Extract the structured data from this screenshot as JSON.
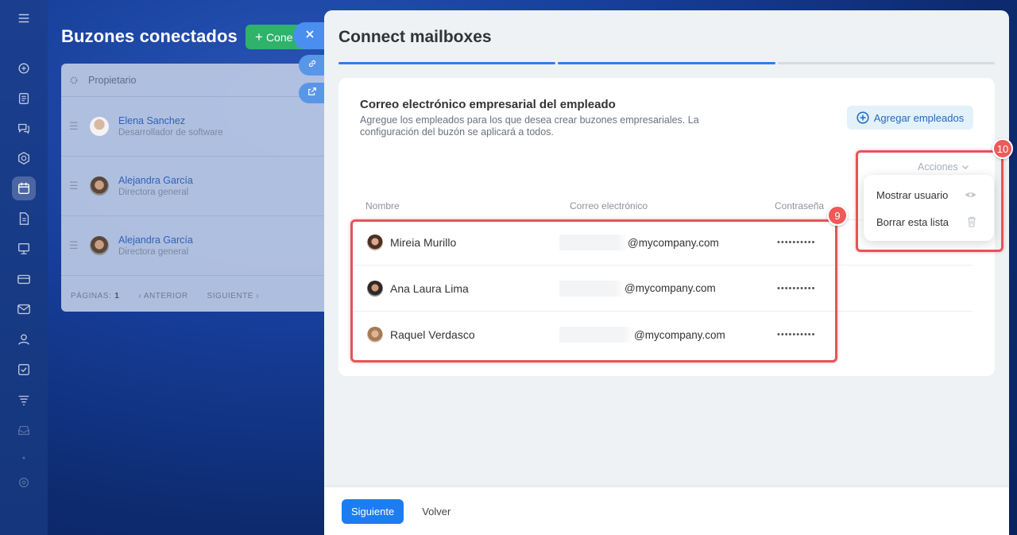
{
  "background": {
    "title": "Buzones conectados",
    "connect_button": "Cone",
    "table": {
      "owner_header": "Propietario",
      "rows": [
        {
          "name": "Elena Sanchez",
          "role": "Desarrollador de software"
        },
        {
          "name": "Alejandra García",
          "role": "Directora general"
        },
        {
          "name": "Alejandra García",
          "role": "Directora general"
        }
      ],
      "pagination": {
        "pages_label": "PÁGINAS:",
        "pages_value": "1",
        "prev": "ANTERIOR",
        "next": "SIGUIENTE"
      }
    }
  },
  "panel": {
    "title": "Connect mailboxes",
    "steps": [
      "done",
      "done",
      "pending"
    ],
    "card": {
      "title": "Correo electrónico empresarial del empleado",
      "description": "Agregue los empleados para los que desea crear buzones empresariales. La configuración del buzón se aplicará a todos.",
      "add_button": "Agregar empleados",
      "actions_label": "Acciones",
      "columns": {
        "name": "Nombre",
        "email": "Correo electrónico",
        "password": "Contraseña"
      },
      "employees": [
        {
          "name": "Mireia Murillo",
          "email_domain": "@mycompany.com",
          "password": "••••••••••"
        },
        {
          "name": "Ana Laura Lima",
          "email_domain": "@mycompany.com",
          "password": "••••••••••"
        },
        {
          "name": "Raquel Verdasco",
          "email_domain": "@mycompany.com",
          "password": "••••••••••"
        }
      ]
    },
    "actions_menu": [
      {
        "label": "Mostrar usuario",
        "icon": "eye-icon"
      },
      {
        "label": "Borrar esta lista",
        "icon": "trash-icon"
      }
    ],
    "footer": {
      "next": "Siguiente",
      "back": "Volver"
    }
  },
  "annotations": {
    "table_badge": "9",
    "menu_badge": "10"
  },
  "colors": {
    "primary": "#1e7cf2",
    "accent_green": "#2fb26a",
    "highlight_red": "#e5545a"
  }
}
